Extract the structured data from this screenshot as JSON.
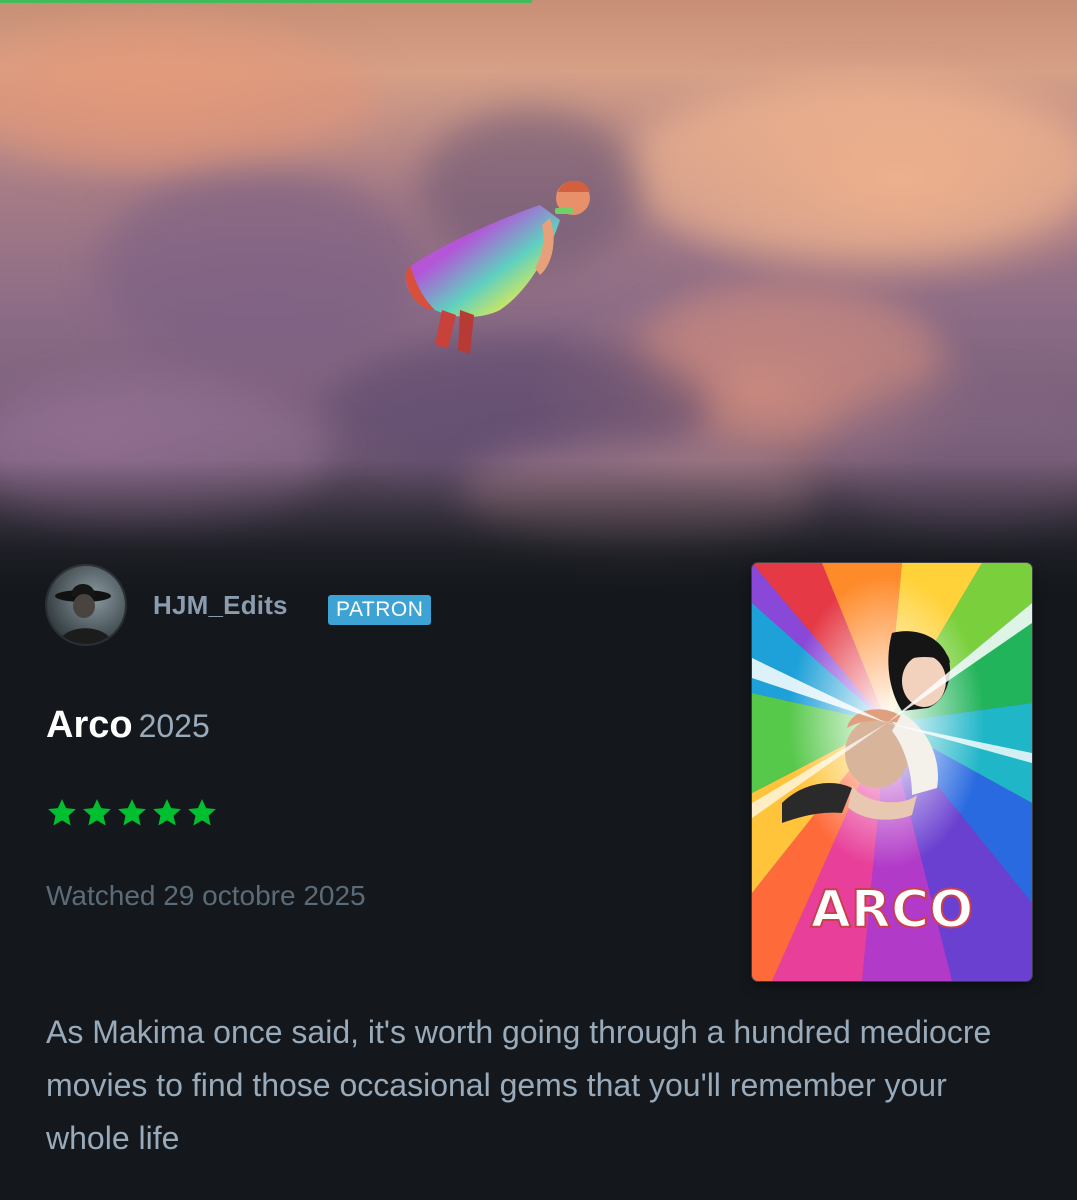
{
  "user": {
    "name": "HJM_Edits",
    "badge": "PATRON"
  },
  "film": {
    "title": "Arco",
    "year": "2025",
    "poster_title": "ARCO"
  },
  "rating": {
    "stars": 5,
    "max": 5,
    "color": "#00c030"
  },
  "watched": "Watched 29 octobre 2025",
  "review": "As Makima once said, it's worth going through a hundred mediocre movies to find those occasional gems that you'll remember your whole life",
  "colors": {
    "background": "#14181c",
    "username": "#8b9caf",
    "badge": "#3da3d4",
    "title": "#ffffff",
    "year": "#99aabb",
    "review_text": "#99aabb",
    "watched_text": "#5c6b78",
    "progress": "#40bc5b"
  },
  "icons": {
    "star": "star-icon",
    "avatar": "avatar",
    "poster": "poster-image",
    "backdrop": "backdrop-image"
  }
}
